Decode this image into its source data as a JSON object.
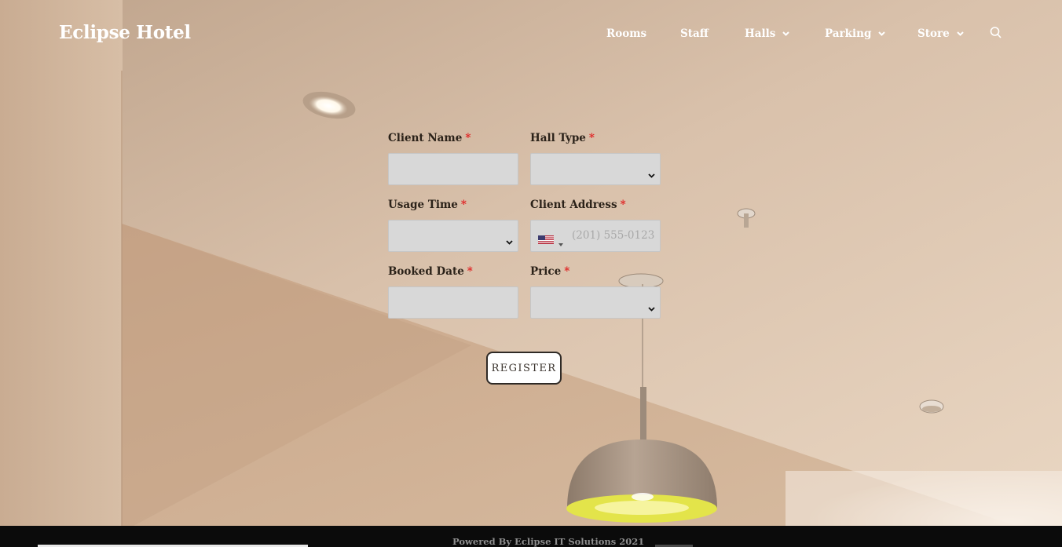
{
  "header": {
    "brand": "Eclipse Hotel",
    "nav": [
      {
        "label": "Rooms",
        "has_dropdown": false
      },
      {
        "label": "Staff",
        "has_dropdown": false
      },
      {
        "label": "Halls",
        "has_dropdown": true
      },
      {
        "label": "Parking",
        "has_dropdown": true
      },
      {
        "label": "Store",
        "has_dropdown": true
      }
    ],
    "search_icon": "search-icon"
  },
  "form": {
    "required_marker": "*",
    "fields": {
      "client_name": {
        "label": "Client Name",
        "value": ""
      },
      "hall_type": {
        "label": "Hall Type",
        "value": ""
      },
      "usage_time": {
        "label": "Usage Time",
        "value": ""
      },
      "client_address": {
        "label": "Client Address",
        "placeholder": "(201) 555-0123",
        "country_flag": "us-flag-icon"
      },
      "booked_date": {
        "label": "Booked Date",
        "value": ""
      },
      "price": {
        "label": "Price",
        "value": ""
      }
    },
    "submit_label": "REGISTER"
  },
  "footer": {
    "text": "Powered By Eclipse IT Solutions 2021"
  },
  "colors": {
    "required": "#e02424",
    "input_bg": "#d8d8d8",
    "footer_bg": "#0b0b0b"
  }
}
